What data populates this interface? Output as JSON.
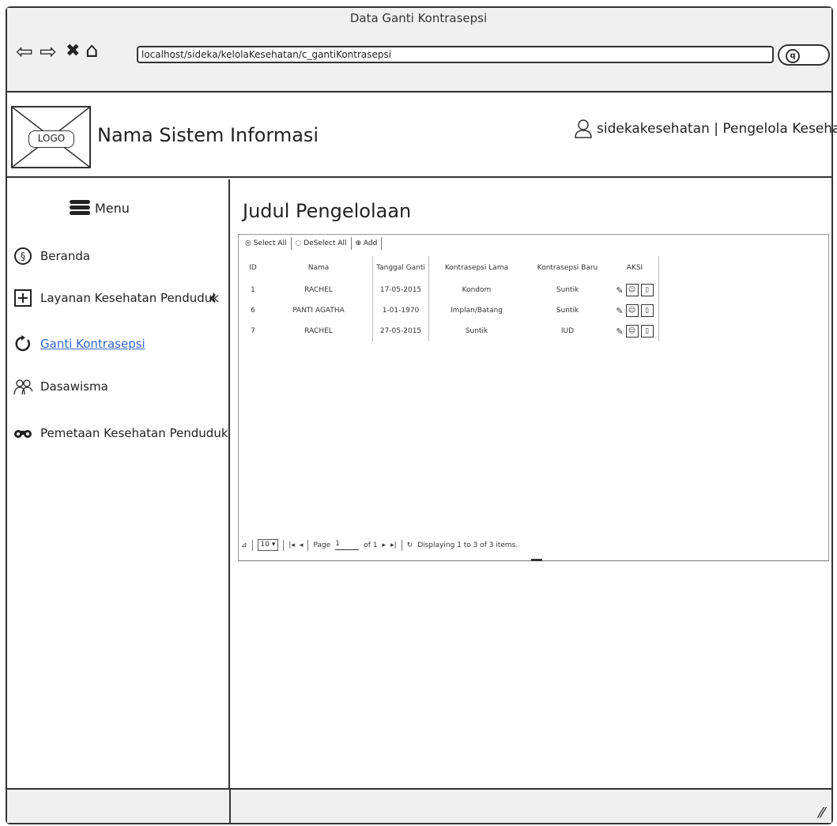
{
  "window": {
    "title": "Data Ganti Kontrasepsi",
    "url": "localhost/sideka/kelolaKesehatan/c_gantiKontrasepsi"
  },
  "header": {
    "logo_text": "LOGO",
    "system_name": "Nama Sistem Informasi",
    "user_label": "sidekakesehatan | Pengelola Kesehatan"
  },
  "sidebar": {
    "menu_label": "Menu",
    "items": [
      {
        "label": "Beranda",
        "icon": "beranda-icon"
      },
      {
        "label": "Layanan Kesehatan Penduduk",
        "icon": "plus-box-icon"
      },
      {
        "label": "Ganti Kontrasepsi",
        "icon": "refresh-icon"
      },
      {
        "label": "Dasawisma",
        "icon": "group-icon"
      },
      {
        "label": "Pemetaan Kesehatan Penduduk",
        "icon": "binoculars-icon"
      }
    ]
  },
  "main": {
    "title": "Judul Pengelolaan",
    "toolbar": {
      "select_all": "Select All",
      "deselect_all": "DeSelect All",
      "add": "Add"
    },
    "table": {
      "headers": [
        "ID",
        "Nama",
        "Tanggal Ganti",
        "Kontrasepsi Lama",
        "Kontrasepsi Baru",
        "AKSI"
      ],
      "rows": [
        [
          "1",
          "RACHEL",
          "17-05-2015",
          "Kondom",
          "Suntik"
        ],
        [
          "6",
          "PANTI AGATHA",
          "1-01-1970",
          "Implan/Batang",
          "Suntik"
        ],
        [
          "7",
          "RACHEL",
          "27-05-2015",
          "Suntik",
          "IUD"
        ]
      ]
    },
    "pager": {
      "page_size": "10",
      "page_label": "Page",
      "page_value": "1",
      "of_label": "of 1",
      "display_text": "Displaying 1 to 3 of 3 items."
    }
  }
}
